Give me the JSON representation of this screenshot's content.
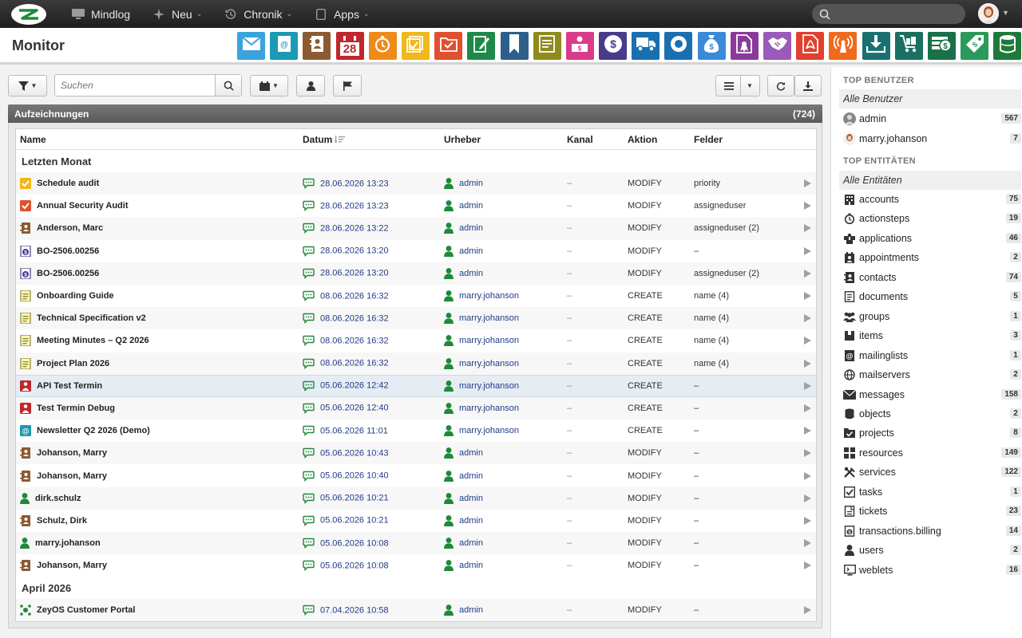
{
  "nav": {
    "items": [
      {
        "label": "Mindlog",
        "icon": "monitor-icon",
        "caret": false
      },
      {
        "label": "Neu",
        "icon": "sparkle-icon",
        "caret": true
      },
      {
        "label": "Chronik",
        "icon": "history-icon",
        "caret": true
      },
      {
        "label": "Apps",
        "icon": "tablet-icon",
        "caret": true
      }
    ]
  },
  "header": {
    "title": "Monitor",
    "tiles": [
      {
        "icon": "mail-icon",
        "color": "#3aa3dc"
      },
      {
        "icon": "mailinglist-icon",
        "color": "#1a9ab3"
      },
      {
        "icon": "contacts-icon",
        "color": "#8b5a32"
      },
      {
        "icon": "calendar-icon",
        "color": "#c0262d",
        "text": "28"
      },
      {
        "icon": "stopwatch-icon",
        "color": "#f08a18"
      },
      {
        "icon": "tasks-icon",
        "color": "#f1b81c"
      },
      {
        "icon": "projects-icon",
        "color": "#e0502e"
      },
      {
        "icon": "documents-icon",
        "color": "#1e8a48"
      },
      {
        "icon": "bookmark-icon",
        "color": "#2d5f8a"
      },
      {
        "icon": "notes-icon",
        "color": "#8f8a1e"
      },
      {
        "icon": "cashier-icon",
        "color": "#d83c8a"
      },
      {
        "icon": "dollar-icon",
        "color": "#4a3a8a"
      },
      {
        "icon": "truck-icon",
        "color": "#1a6fb0"
      },
      {
        "icon": "support-icon",
        "color": "#1a6fb0"
      },
      {
        "icon": "moneybag-icon",
        "color": "#3a8ad8"
      },
      {
        "icon": "contract-icon",
        "color": "#8a3a9a"
      },
      {
        "icon": "handshake-icon",
        "color": "#9a5ab8"
      },
      {
        "icon": "pdf-icon",
        "color": "#e0402e"
      },
      {
        "icon": "broadcast-icon",
        "color": "#f06a1e"
      },
      {
        "icon": "download-icon",
        "color": "#1a7070"
      },
      {
        "icon": "cart-icon",
        "color": "#1a7060"
      },
      {
        "icon": "cash-icon",
        "color": "#1a7048"
      },
      {
        "icon": "price-tag-icon",
        "color": "#2a9a5a"
      },
      {
        "icon": "database-icon",
        "color": "#1e7a3a"
      }
    ]
  },
  "toolbar": {
    "search_placeholder": "Suchen"
  },
  "panel": {
    "title": "Aufzeichnungen",
    "count": "(724)"
  },
  "table": {
    "columns": {
      "name": "Name",
      "date": "Datum",
      "user": "Urheber",
      "kanal": "Kanal",
      "aktion": "Aktion",
      "felder": "Felder"
    },
    "groups": [
      {
        "label": "Letzten Monat",
        "rows": [
          {
            "name": "Schedule audit",
            "icon": "tasks-icon",
            "color": "#f1b81c",
            "date": "28.06.2026 13:23",
            "user": "admin",
            "kanal": "–",
            "aktion": "MODIFY",
            "felder": "priority"
          },
          {
            "name": "Annual Security Audit",
            "icon": "projects-icon",
            "color": "#e0502e",
            "date": "28.06.2026 13:23",
            "user": "admin",
            "kanal": "–",
            "aktion": "MODIFY",
            "felder": "assigneduser"
          },
          {
            "name": "Anderson, Marc",
            "icon": "contacts-icon",
            "color": "#8b5a32",
            "date": "28.06.2026 13:22",
            "user": "admin",
            "kanal": "–",
            "aktion": "MODIFY",
            "felder": "assigneduser (2)"
          },
          {
            "name": "BO-2506.00256",
            "icon": "dollar-icon",
            "color": "#4a3a8a",
            "date": "28.06.2026 13:20",
            "user": "admin",
            "kanal": "–",
            "aktion": "MODIFY",
            "felder": "–"
          },
          {
            "name": "BO-2506.00256",
            "icon": "dollar-icon",
            "color": "#4a3a8a",
            "date": "28.06.2026 13:20",
            "user": "admin",
            "kanal": "–",
            "aktion": "MODIFY",
            "felder": "assigneduser (2)"
          },
          {
            "name": "Onboarding Guide",
            "icon": "notes-icon",
            "color": "#8f8a1e",
            "date": "08.06.2026 16:32",
            "user": "marry.johanson",
            "kanal": "–",
            "aktion": "CREATE",
            "felder": "name (4)"
          },
          {
            "name": "Technical Specification v2",
            "icon": "notes-icon",
            "color": "#8f8a1e",
            "date": "08.06.2026 16:32",
            "user": "marry.johanson",
            "kanal": "–",
            "aktion": "CREATE",
            "felder": "name (4)"
          },
          {
            "name": "Meeting Minutes – Q2 2026",
            "icon": "notes-icon",
            "color": "#8f8a1e",
            "date": "08.06.2026 16:32",
            "user": "marry.johanson",
            "kanal": "–",
            "aktion": "CREATE",
            "felder": "name (4)"
          },
          {
            "name": "Project Plan 2026",
            "icon": "notes-icon",
            "color": "#8f8a1e",
            "date": "08.06.2026 16:32",
            "user": "marry.johanson",
            "kanal": "–",
            "aktion": "CREATE",
            "felder": "name (4)"
          },
          {
            "name": "API Test Termin",
            "icon": "cashier-icon",
            "color": "#c0262d",
            "date": "05.06.2026 12:42",
            "user": "marry.johanson",
            "kanal": "–",
            "aktion": "CREATE",
            "felder": "–",
            "highlight": true
          },
          {
            "name": "Test Termin Debug",
            "icon": "cashier-icon",
            "color": "#c0262d",
            "date": "05.06.2026 12:40",
            "user": "marry.johanson",
            "kanal": "–",
            "aktion": "CREATE",
            "felder": "–"
          },
          {
            "name": "Newsletter Q2 2026 (Demo)",
            "icon": "mailinglist-icon",
            "color": "#1a9ab3",
            "date": "05.06.2026 11:01",
            "user": "marry.johanson",
            "kanal": "–",
            "aktion": "CREATE",
            "felder": "–"
          },
          {
            "name": "Johanson, Marry",
            "icon": "contacts-icon",
            "color": "#8b5a32",
            "date": "05.06.2026 10:43",
            "user": "admin",
            "kanal": "–",
            "aktion": "MODIFY",
            "felder": "–"
          },
          {
            "name": "Johanson, Marry",
            "icon": "contacts-icon",
            "color": "#8b5a32",
            "date": "05.06.2026 10:40",
            "user": "admin",
            "kanal": "–",
            "aktion": "MODIFY",
            "felder": "–"
          },
          {
            "name": "dirk.schulz",
            "icon": "user-icon",
            "color": "#1e8a3a",
            "date": "05.06.2026 10:21",
            "user": "admin",
            "kanal": "–",
            "aktion": "MODIFY",
            "felder": "–"
          },
          {
            "name": "Schulz, Dirk",
            "icon": "contacts-icon",
            "color": "#8b5a32",
            "date": "05.06.2026 10:21",
            "user": "admin",
            "kanal": "–",
            "aktion": "MODIFY",
            "felder": "–"
          },
          {
            "name": "marry.johanson",
            "icon": "user-icon",
            "color": "#1e8a3a",
            "date": "05.06.2026 10:08",
            "user": "admin",
            "kanal": "–",
            "aktion": "MODIFY",
            "felder": "–"
          },
          {
            "name": "Johanson, Marry",
            "icon": "contacts-icon",
            "color": "#8b5a32",
            "date": "05.06.2026 10:08",
            "user": "admin",
            "kanal": "–",
            "aktion": "MODIFY",
            "felder": "–"
          }
        ]
      },
      {
        "label": "April 2026",
        "rows": [
          {
            "name": "ZeyOS Customer Portal",
            "icon": "portal-icon",
            "color": "#1e8a3a",
            "date": "07.04.2026 10:58",
            "user": "admin",
            "kanal": "–",
            "aktion": "MODIFY",
            "felder": "–"
          }
        ]
      }
    ]
  },
  "sidebar": {
    "top_users_title": "TOP BENUTZER",
    "all_users": "Alle Benutzer",
    "users": [
      {
        "name": "admin",
        "count": "567"
      },
      {
        "name": "marry.johanson",
        "count": "7"
      }
    ],
    "top_entities_title": "TOP ENTITÄTEN",
    "all_entities": "Alle Entitäten",
    "entities": [
      {
        "name": "accounts",
        "icon": "building-icon",
        "count": "75"
      },
      {
        "name": "actionsteps",
        "icon": "stopwatch-icon",
        "count": "19"
      },
      {
        "name": "applications",
        "icon": "puzzle-icon",
        "count": "46"
      },
      {
        "name": "appointments",
        "icon": "calendar-icon",
        "count": "2"
      },
      {
        "name": "contacts",
        "icon": "contacts-icon",
        "count": "74"
      },
      {
        "name": "documents",
        "icon": "documents-icon",
        "count": "5"
      },
      {
        "name": "groups",
        "icon": "group-icon",
        "count": "1"
      },
      {
        "name": "items",
        "icon": "box-icon",
        "count": "3"
      },
      {
        "name": "mailinglists",
        "icon": "mailinglist-icon",
        "count": "1"
      },
      {
        "name": "mailservers",
        "icon": "globe-icon",
        "count": "2"
      },
      {
        "name": "messages",
        "icon": "envelope-icon",
        "count": "158"
      },
      {
        "name": "objects",
        "icon": "database-icon",
        "count": "2"
      },
      {
        "name": "projects",
        "icon": "projects-icon",
        "count": "8"
      },
      {
        "name": "resources",
        "icon": "grid-icon",
        "count": "149"
      },
      {
        "name": "services",
        "icon": "tools-icon",
        "count": "122"
      },
      {
        "name": "tasks",
        "icon": "tasks-icon",
        "count": "1"
      },
      {
        "name": "tickets",
        "icon": "ticket-icon",
        "count": "23"
      },
      {
        "name": "transactions.billing",
        "icon": "dollar-icon",
        "count": "14"
      },
      {
        "name": "users",
        "icon": "user-icon",
        "count": "2"
      },
      {
        "name": "weblets",
        "icon": "screen-icon",
        "count": "16"
      }
    ]
  }
}
